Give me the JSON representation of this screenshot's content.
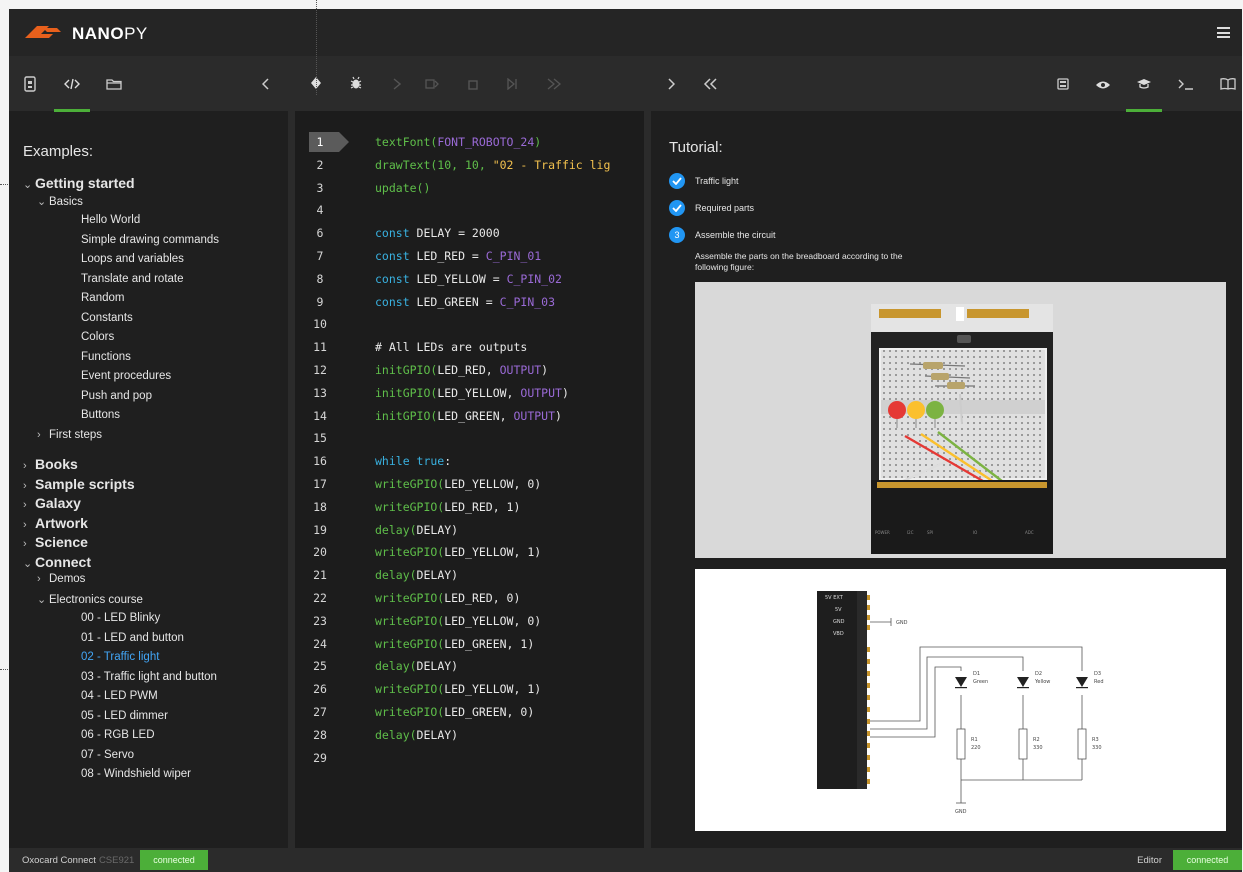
{
  "app": {
    "brand_bold": "NANO",
    "brand_rest": "PY"
  },
  "left_toolbar": {
    "icons": [
      "device-icon",
      "code-icon",
      "folder-icon",
      "collapse-left-icon"
    ]
  },
  "examples": {
    "title": "Examples:",
    "tree": [
      {
        "label": "Getting started",
        "level": 0,
        "chevron": "v"
      },
      {
        "label": "Basics",
        "level": 1,
        "chevron": "v"
      },
      {
        "label": "Hello World",
        "level": 2
      },
      {
        "label": "Simple drawing commands",
        "level": 2
      },
      {
        "label": "Loops and variables",
        "level": 2
      },
      {
        "label": "Translate and rotate",
        "level": 2
      },
      {
        "label": "Random",
        "level": 2
      },
      {
        "label": "Constants",
        "level": 2
      },
      {
        "label": "Colors",
        "level": 2
      },
      {
        "label": "Functions",
        "level": 2
      },
      {
        "label": "Event procedures",
        "level": 2
      },
      {
        "label": "Push and pop",
        "level": 2
      },
      {
        "label": "Buttons",
        "level": 2
      },
      {
        "label": "First steps",
        "level": 1,
        "chevron": ">"
      },
      {
        "label": "Books",
        "level": 0,
        "chevron": ">"
      },
      {
        "label": "Sample scripts",
        "level": 0,
        "chevron": ">"
      },
      {
        "label": "Galaxy",
        "level": 0,
        "chevron": ">"
      },
      {
        "label": "Artwork",
        "level": 0,
        "chevron": ">"
      },
      {
        "label": "Science",
        "level": 0,
        "chevron": ">"
      },
      {
        "label": "Connect",
        "level": 0,
        "chevron": "v"
      },
      {
        "label": "Demos",
        "level": 1,
        "chevron": ">"
      },
      {
        "label": "Electronics course",
        "level": 1,
        "chevron": "v"
      },
      {
        "label": "00 - LED Blinky",
        "level": 2
      },
      {
        "label": "01 - LED and button",
        "level": 2
      },
      {
        "label": "02 - Traffic light",
        "level": 2,
        "selected": true
      },
      {
        "label": "03 - Traffic light and button",
        "level": 2
      },
      {
        "label": "04 - LED PWM",
        "level": 2
      },
      {
        "label": "05 - LED dimmer",
        "level": 2
      },
      {
        "label": "06 - RGB LED",
        "level": 2
      },
      {
        "label": "07 - Servo",
        "level": 2
      },
      {
        "label": "08 - Windshield wiper",
        "level": 2
      }
    ]
  },
  "editor": {
    "lines": [
      [
        {
          "t": "textFont(",
          "c": "f"
        },
        {
          "t": "FONT_ROBOTO_24",
          "c": "c"
        },
        {
          "t": ")",
          "c": "f"
        }
      ],
      [
        {
          "t": "drawText(10, 10, ",
          "c": "f"
        },
        {
          "t": "\"02 - Traffic lig",
          "c": "s"
        }
      ],
      [
        {
          "t": "update()",
          "c": "f"
        }
      ],
      [],
      [
        {
          "t": "const ",
          "c": "k"
        },
        {
          "t": "DELAY = 2000",
          "c": "t"
        }
      ],
      [
        {
          "t": "const ",
          "c": "k"
        },
        {
          "t": "LED_RED = ",
          "c": "t"
        },
        {
          "t": "C_PIN_01",
          "c": "c"
        }
      ],
      [
        {
          "t": "const ",
          "c": "k"
        },
        {
          "t": "LED_YELLOW = ",
          "c": "t"
        },
        {
          "t": "C_PIN_02",
          "c": "c"
        }
      ],
      [
        {
          "t": "const ",
          "c": "k"
        },
        {
          "t": "LED_GREEN = ",
          "c": "t"
        },
        {
          "t": "C_PIN_03",
          "c": "c"
        }
      ],
      [],
      [
        {
          "t": "# All LEDs are outputs",
          "c": "t"
        }
      ],
      [
        {
          "t": "initGPIO(",
          "c": "f"
        },
        {
          "t": "LED_RED, ",
          "c": "t"
        },
        {
          "t": "OUTPUT",
          "c": "c"
        },
        {
          "t": ")",
          "c": "t"
        }
      ],
      [
        {
          "t": "initGPIO(",
          "c": "f"
        },
        {
          "t": "LED_YELLOW, ",
          "c": "t"
        },
        {
          "t": "OUTPUT",
          "c": "c"
        },
        {
          "t": ")",
          "c": "t"
        }
      ],
      [
        {
          "t": "initGPIO(",
          "c": "f"
        },
        {
          "t": "LED_GREEN, ",
          "c": "t"
        },
        {
          "t": "OUTPUT",
          "c": "c"
        },
        {
          "t": ")",
          "c": "t"
        }
      ],
      [],
      [
        {
          "t": "while true",
          "c": "k"
        },
        {
          "t": ":",
          "c": "t"
        }
      ],
      [
        {
          "t": "writeGPIO(",
          "c": "f"
        },
        {
          "t": "LED_YELLOW, 0)",
          "c": "t"
        }
      ],
      [
        {
          "t": "writeGPIO(",
          "c": "f"
        },
        {
          "t": "LED_RED, 1)",
          "c": "t"
        }
      ],
      [
        {
          "t": "delay(",
          "c": "f"
        },
        {
          "t": "DELAY)",
          "c": "t"
        }
      ],
      [
        {
          "t": "writeGPIO(",
          "c": "f"
        },
        {
          "t": "LED_YELLOW, 1)",
          "c": "t"
        }
      ],
      [
        {
          "t": "delay(",
          "c": "f"
        },
        {
          "t": "DELAY)",
          "c": "t"
        }
      ],
      [
        {
          "t": "writeGPIO(",
          "c": "f"
        },
        {
          "t": "LED_RED, 0)",
          "c": "t"
        }
      ],
      [
        {
          "t": "writeGPIO(",
          "c": "f"
        },
        {
          "t": "LED_YELLOW, 0)",
          "c": "t"
        }
      ],
      [
        {
          "t": "writeGPIO(",
          "c": "f"
        },
        {
          "t": "LED_GREEN, 1)",
          "c": "t"
        }
      ],
      [
        {
          "t": "delay(",
          "c": "f"
        },
        {
          "t": "DELAY)",
          "c": "t"
        }
      ],
      [
        {
          "t": "writeGPIO(",
          "c": "f"
        },
        {
          "t": "LED_YELLOW, 1)",
          "c": "t"
        }
      ],
      [
        {
          "t": "writeGPIO(",
          "c": "f"
        },
        {
          "t": "LED_GREEN, 0)",
          "c": "t"
        }
      ],
      [
        {
          "t": "delay(",
          "c": "f"
        },
        {
          "t": "DELAY)",
          "c": "t"
        }
      ],
      []
    ],
    "line_numbers": [
      "1",
      "2",
      "3",
      "4",
      "6",
      "7",
      "8",
      "9",
      "10",
      "11",
      "12",
      "13",
      "14",
      "15",
      "16",
      "17",
      "18",
      "19",
      "20",
      "21",
      "22",
      "23",
      "24",
      "25",
      "26",
      "27",
      "28",
      "29"
    ],
    "current_line": "1"
  },
  "tutorial": {
    "title": "Tutorial:",
    "steps": [
      {
        "label": "Traffic light",
        "state": "done"
      },
      {
        "label": "Required parts",
        "state": "done"
      },
      {
        "label": "Assemble the circuit",
        "state": "current",
        "number": "3"
      }
    ],
    "description": "Assemble the parts on the breadboard according to the following figure:",
    "schematic": {
      "pins_top": [
        "5V EXT",
        "5V",
        "GND",
        "VBD"
      ],
      "gnd_label": "GND",
      "leds": [
        {
          "ref": "D1",
          "name": "Green"
        },
        {
          "ref": "D2",
          "name": "Yellow"
        },
        {
          "ref": "D3",
          "name": "Red"
        }
      ],
      "resistors": [
        {
          "ref": "R1",
          "value": "220"
        },
        {
          "ref": "R2",
          "value": "330"
        },
        {
          "ref": "R3",
          "value": "330"
        }
      ],
      "bottom_label": "GND"
    }
  },
  "status": {
    "left_label": "Oxocard Connect",
    "device_id": "CSE921",
    "left_badge": "connected",
    "editor_label": "Editor",
    "right_badge": "connected"
  },
  "colors": {
    "accent_green": "#4caf39",
    "selection_blue": "#42a5f5",
    "step_blue": "#2196f3",
    "logo_orange": "#e8601c"
  }
}
